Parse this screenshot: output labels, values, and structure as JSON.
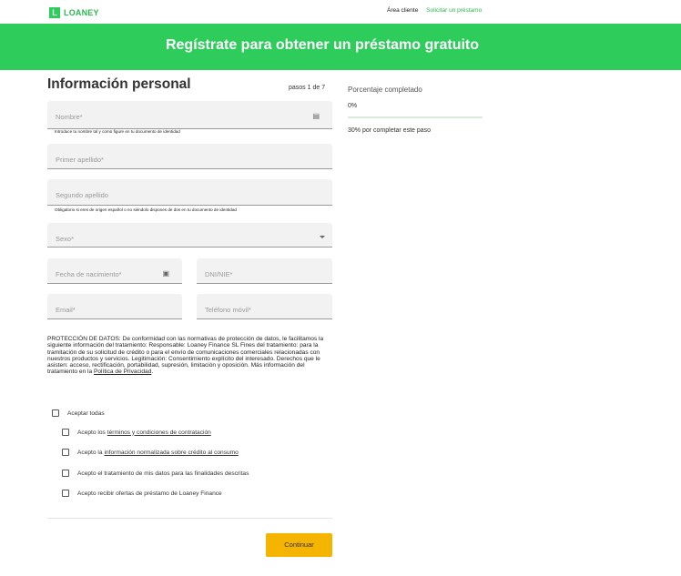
{
  "header": {
    "logo_mark": "L",
    "logo_text": "LOANEY",
    "nav_area_cliente": "Área cliente",
    "nav_solicitar": "Solicitar un préstamo"
  },
  "banner": {
    "title": "Regístrate para obtener un préstamo gratuito"
  },
  "form": {
    "section_title": "Información personal",
    "steps": "pasos 1 de 7",
    "fields": {
      "nombre": {
        "label": "Nombre*",
        "helper": "Introduce tu nombre tal y como figure en tu documento de identidad"
      },
      "primer_apellido": {
        "label": "Primer apellido*"
      },
      "segundo_apellido": {
        "label": "Segundo apellido",
        "helper": "Obligatorio si eres de origen español o no siéndolo dispones de dos en tu documento de identidad"
      },
      "sexo": {
        "label": "Sexo*"
      },
      "fecha_nacimiento": {
        "label": "Fecha de nacimiento*"
      },
      "dni_nie": {
        "label": "DNI/NIE*"
      },
      "email": {
        "label": "Email*"
      },
      "telefono": {
        "label": "Teléfono móvil*"
      }
    },
    "privacy_text": "PROTECCIÓN DE DATOS: De conformidad con las normativas de protección de datos, le facilitamos la siguiente información del tratamiento: Responsable: Loaney Finance SL Fines del tratamiento: para la tramitación de su solicitud de crédito o para el envío de comunicaciones comerciales relacionadas con nuestros productos y servicios. Legitimación: Consentimiento explícito del interesado. Derechos que le asisten: acceso, rectificación, portabilidad, supresión, limitación y oposición. Más información del tratamiento en la ",
    "privacy_link": "Política de Privacidad",
    "privacy_end": ".",
    "checks": {
      "all": "Aceptar todas",
      "terms_prefix": "Acepto los",
      "terms_link": "términos y condiciones de contratación",
      "info_prefix": "Acepto la",
      "info_link": "información normalizada sobre crédito al consumo",
      "data_treatment": "Acepto el tratamiento de mis datos para las finalidades descritas",
      "offers": "Acepto recibir ofertas de préstamo de Loaney Finance"
    },
    "continue_label": "Continuar"
  },
  "progress": {
    "label": "Porcentaje completado",
    "value_text": "0%",
    "value": 0,
    "note": "30% por completar este paso"
  },
  "colors": {
    "brand_green": "#2ecc5b",
    "button_yellow": "#f5b400"
  },
  "icons": {
    "nombre_field": "id-card-icon",
    "fecha_field": "calendar-icon",
    "sexo_field": "dropdown-arrow-icon"
  }
}
